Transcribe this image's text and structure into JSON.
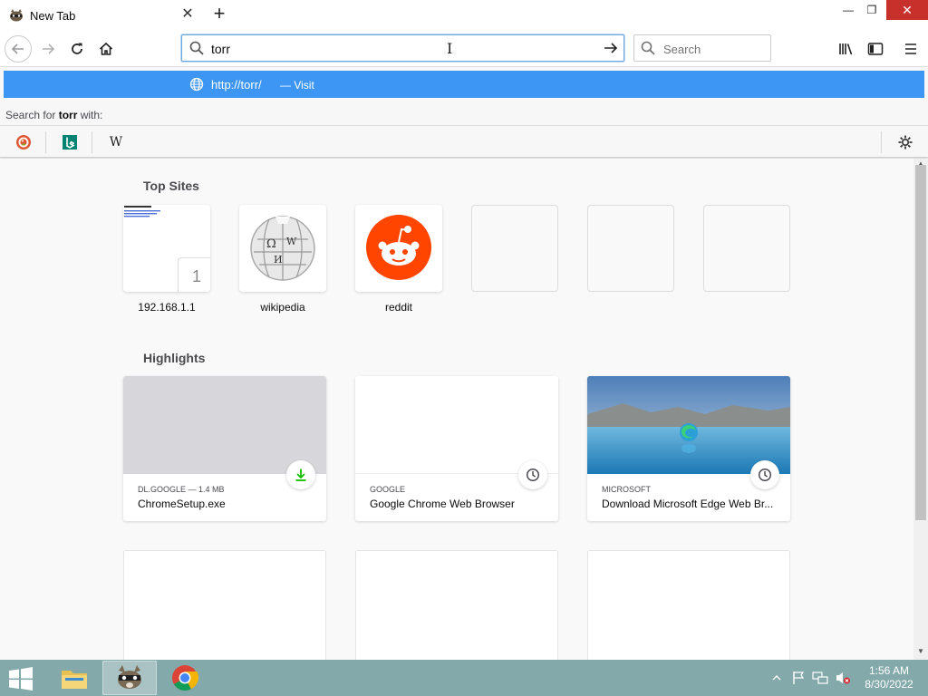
{
  "window": {
    "minimize_glyph": "—",
    "maximize_glyph": "❐",
    "close_glyph": "✕"
  },
  "tabs": [
    {
      "title": "New Tab",
      "icon": "raccoon-favicon-icon",
      "active": true
    }
  ],
  "new_tab_glyph": "+",
  "urlbar": {
    "value": "torr",
    "placeholder": ""
  },
  "searchbar": {
    "placeholder": "Search"
  },
  "dropdown": {
    "suggestion": {
      "url": "http://torr/",
      "action": "— Visit"
    },
    "search_for_prefix": "Search for ",
    "search_for_term": "torr",
    "search_for_suffix": " with:",
    "engines": [
      {
        "name": "DuckDuckGo",
        "icon": "duckduckgo-icon"
      },
      {
        "name": "Bing",
        "icon": "bing-icon"
      },
      {
        "name": "Wikipedia",
        "icon": "wikipedia-icon",
        "glyph": "W"
      }
    ]
  },
  "top_sites": {
    "title": "Top Sites",
    "items": [
      {
        "label": "192.168.1.1",
        "badge": "1"
      },
      {
        "label": "wikipedia"
      },
      {
        "label": "reddit"
      },
      {
        "label": ""
      },
      {
        "label": ""
      },
      {
        "label": ""
      }
    ]
  },
  "highlights": {
    "title": "Highlights",
    "items": [
      {
        "meta": "DL.GOOGLE — 1.4 MB",
        "title": "ChromeSetup.exe",
        "badge_icon": "download-icon"
      },
      {
        "meta": "GOOGLE",
        "title": "Google Chrome Web Browser",
        "badge_icon": "history-clock-icon"
      },
      {
        "meta": "MICROSOFT",
        "title": "Download Microsoft Edge Web Br...",
        "badge_icon": "history-clock-icon"
      }
    ]
  },
  "taskbar": {
    "clock_time": "1:56 AM",
    "clock_date": "8/30/2022"
  },
  "colors": {
    "accent": "#3d96f4",
    "taskbar": "#83a9aa",
    "close": "#c8312b",
    "reddit": "#ff4500",
    "download_green": "#12bc00"
  }
}
